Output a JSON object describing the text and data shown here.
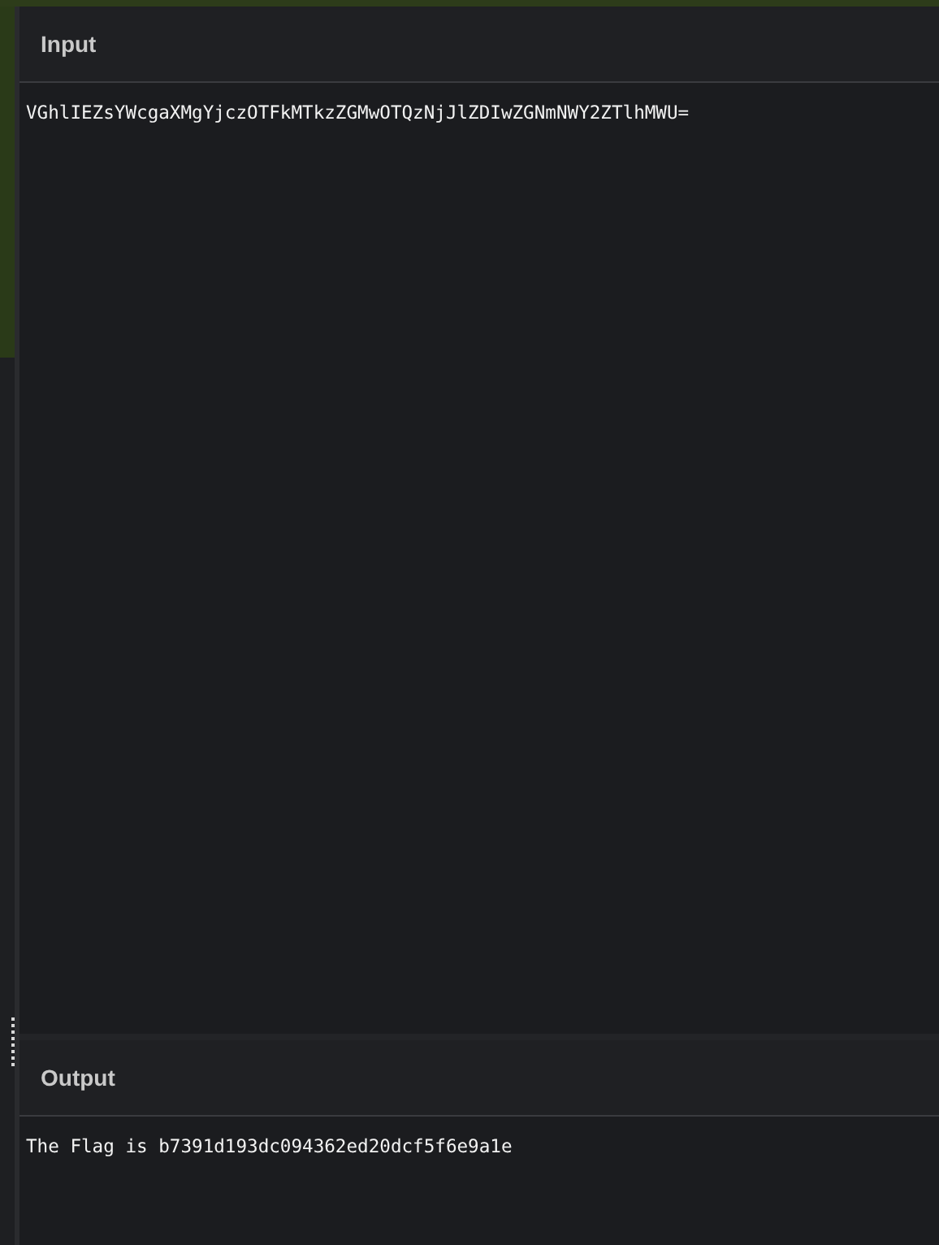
{
  "input": {
    "title": "Input",
    "value": "VGhlIEZsYWcgaXMgYjczOTFkMTkzZGMwOTQzNjJlZDIwZGNmNWY2ZTlhMWU="
  },
  "output": {
    "title": "Output",
    "value": "The Flag is b7391d193dc094362ed20dcf5f6e9a1e"
  }
}
